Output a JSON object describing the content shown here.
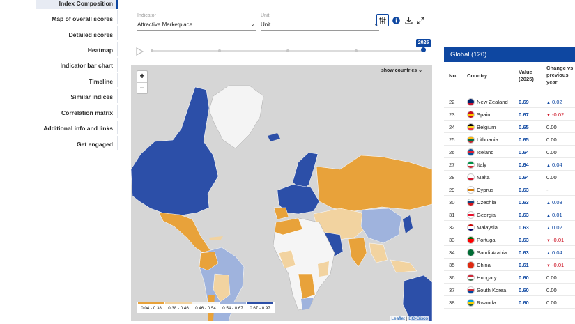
{
  "sidebar": {
    "items": [
      {
        "label": "Index Composition",
        "active": true
      },
      {
        "label": "Map of overall scores"
      },
      {
        "label": "Detailed scores"
      },
      {
        "label": "Heatmap"
      },
      {
        "label": "Indicator bar chart"
      },
      {
        "label": "Timeline"
      },
      {
        "label": "Similar indices"
      },
      {
        "label": "Correlation matrix"
      },
      {
        "label": "Additional info and links"
      },
      {
        "label": "Get engaged"
      }
    ]
  },
  "controls": {
    "indicator_label": "Indicator",
    "indicator_value": "Attractive Marketplace",
    "unit_label": "Unit",
    "unit_value": "Unit",
    "year": "2025"
  },
  "map": {
    "show_countries_label": "show countries",
    "zoom_in": "+",
    "zoom_out": "−",
    "legend": [
      {
        "range": "0.04 - 0.38",
        "color": "#e8a23a"
      },
      {
        "range": "0.38 - 0.46",
        "color": "#f2d3a0"
      },
      {
        "range": "0.46 - 0.54",
        "color": "#f5f5f5"
      },
      {
        "range": "0.54 - 0.67",
        "color": "#9fb3dd"
      },
      {
        "range": "0.67 - 0.97",
        "color": "#2c4fa8"
      }
    ],
    "attribution_leaflet": "Leaflet",
    "attribution_sep": " | ",
    "attribution_gisco": "EC-Gisco"
  },
  "ranking": {
    "title": "Global (120)",
    "headers": {
      "no": "No.",
      "country": "Country",
      "value": "Value (2025)",
      "change": "Change vs previous year"
    },
    "rows": [
      {
        "no": "22",
        "country": "New Zealand",
        "value": "0.69",
        "change": "0.02",
        "dir": "up"
      },
      {
        "no": "23",
        "country": "Spain",
        "value": "0.67",
        "change": "-0.02",
        "dir": "down"
      },
      {
        "no": "24",
        "country": "Belgium",
        "value": "0.65",
        "change": "0.00",
        "dir": "none"
      },
      {
        "no": "25",
        "country": "Lithuania",
        "value": "0.65",
        "change": "0.00",
        "dir": "none"
      },
      {
        "no": "26",
        "country": "Iceland",
        "value": "0.64",
        "change": "0.00",
        "dir": "none"
      },
      {
        "no": "27",
        "country": "Italy",
        "value": "0.64",
        "change": "0.04",
        "dir": "up"
      },
      {
        "no": "28",
        "country": "Malta",
        "value": "0.64",
        "change": "0.00",
        "dir": "none"
      },
      {
        "no": "29",
        "country": "Cyprus",
        "value": "0.63",
        "change": "-",
        "dir": "none"
      },
      {
        "no": "30",
        "country": "Czechia",
        "value": "0.63",
        "change": "0.03",
        "dir": "up"
      },
      {
        "no": "31",
        "country": "Georgia",
        "value": "0.63",
        "change": "0.01",
        "dir": "up"
      },
      {
        "no": "32",
        "country": "Malaysia",
        "value": "0.63",
        "change": "0.02",
        "dir": "up"
      },
      {
        "no": "33",
        "country": "Portugal",
        "value": "0.63",
        "change": "-0.01",
        "dir": "down"
      },
      {
        "no": "34",
        "country": "Saudi Arabia",
        "value": "0.63",
        "change": "0.04",
        "dir": "up"
      },
      {
        "no": "35",
        "country": "China",
        "value": "0.61",
        "change": "-0.01",
        "dir": "down"
      },
      {
        "no": "36",
        "country": "Hungary",
        "value": "0.60",
        "change": "0.00",
        "dir": "none"
      },
      {
        "no": "37",
        "country": "South Korea",
        "value": "0.60",
        "change": "0.00",
        "dir": "none"
      },
      {
        "no": "38",
        "country": "Rwanda",
        "value": "0.60",
        "change": "0.00",
        "dir": "none"
      }
    ]
  },
  "colors": {
    "accent": "#0e47a1",
    "up": "#0e47a1",
    "down": "#cc1122"
  }
}
